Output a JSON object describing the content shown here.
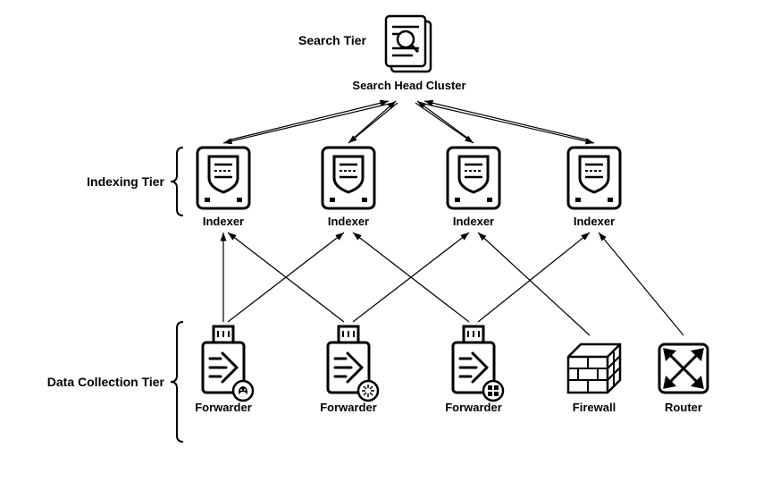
{
  "tiers": {
    "search": {
      "label": "Search Tier",
      "cluster_label": "Search Head Cluster"
    },
    "indexing": {
      "label": "Indexing Tier"
    },
    "data": {
      "label": "Data Collection Tier"
    }
  },
  "indexers": [
    {
      "label": "Indexer"
    },
    {
      "label": "Indexer"
    },
    {
      "label": "Indexer"
    },
    {
      "label": "Indexer"
    }
  ],
  "forwarders": [
    {
      "label": "Forwarder",
      "os_icon": "linux"
    },
    {
      "label": "Forwarder",
      "os_icon": "sun"
    },
    {
      "label": "Forwarder",
      "os_icon": "windows"
    }
  ],
  "network": {
    "firewall": {
      "label": "Firewall"
    },
    "router": {
      "label": "Router"
    }
  }
}
